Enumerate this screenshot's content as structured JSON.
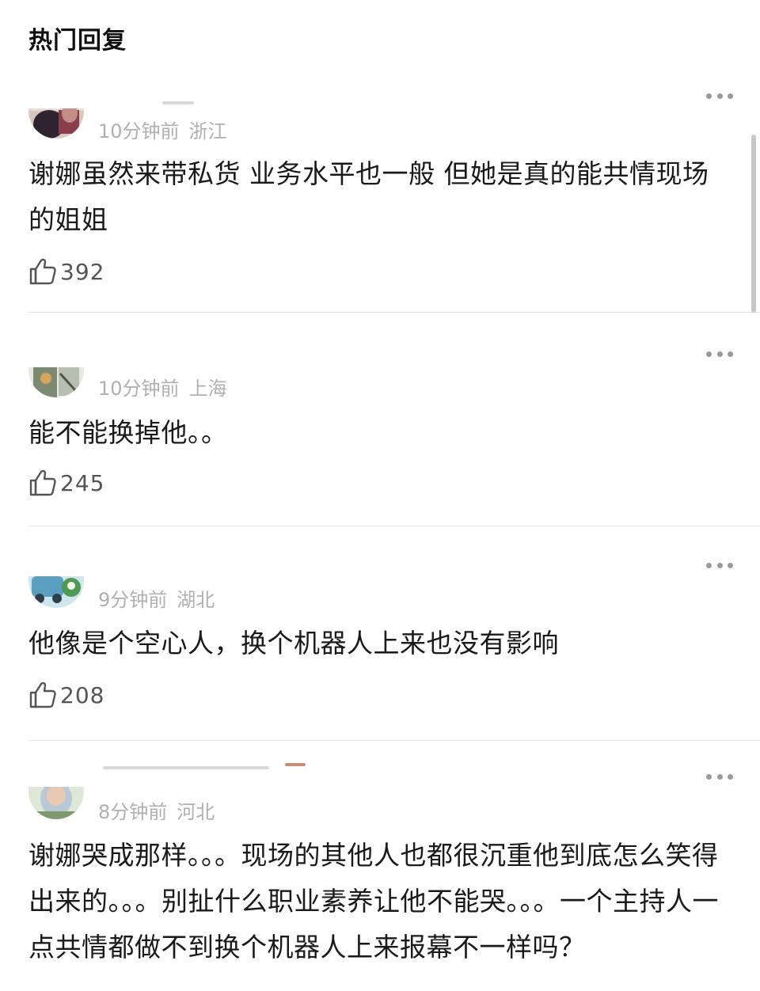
{
  "header": {
    "title": "热门回复"
  },
  "comments": [
    {
      "time": "10分钟前",
      "location": "浙江",
      "text": "谢娜虽然来带私货 业务水平也一般 但她是真的能共情现场的姐姐",
      "likes": "392",
      "avatar_icon": "user-avatar-icon"
    },
    {
      "time": "10分钟前",
      "location": "上海",
      "text": "能不能换掉他。。",
      "likes": "245",
      "avatar_icon": "user-avatar-icon"
    },
    {
      "time": "9分钟前",
      "location": "湖北",
      "text": "他像是个空心人，换个机器人上来也没有影响",
      "likes": "208",
      "avatar_icon": "user-avatar-icon"
    },
    {
      "time": "8分钟前",
      "location": "河北",
      "text": "谢娜哭成那样。。。现场的其他人也都很沉重他到底怎么笑得出来的。。。别扯什么职业素养让他不能哭。。。一个主持人一点共情都做不到换个机器人上来报幕不一样吗？",
      "likes": "",
      "avatar_icon": "user-avatar-icon"
    }
  ],
  "icons": {
    "like": "thumbs-up-icon",
    "more": "more-dots-icon"
  },
  "colors": {
    "meta_text": "#b0b0b0",
    "body_text": "#1a1a1a",
    "divider": "#e6e6e6"
  }
}
